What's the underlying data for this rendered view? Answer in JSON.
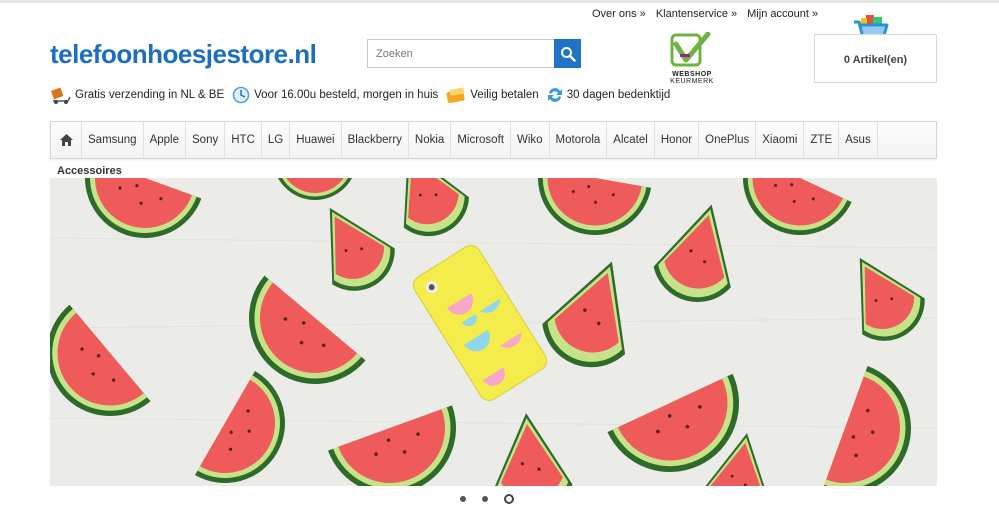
{
  "toplinks": {
    "about": "Over ons »",
    "service": "Klantenservice »",
    "account": "Mijn account »"
  },
  "logo": {
    "text_main": "telefoonhoesjestore",
    "text_tld": ".nl"
  },
  "search": {
    "placeholder": "Zoeken",
    "value": ""
  },
  "keurmerk": {
    "line1": "WEBSHOP",
    "line2": "KEURMERK"
  },
  "cart": {
    "label": "0 Artikel(en)"
  },
  "usps": [
    {
      "icon": "delivery-truck-icon",
      "text": "Gratis verzending in NL & BE"
    },
    {
      "icon": "clock-icon",
      "text": "Voor 16.00u besteld, morgen in huis"
    },
    {
      "icon": "wallet-icon",
      "text": "Veilig betalen"
    },
    {
      "icon": "return-arrows-icon",
      "text": "30 dagen bedenktijd"
    }
  ],
  "nav": {
    "items": [
      "Samsung",
      "Apple",
      "Sony",
      "HTC",
      "LG",
      "Huawei",
      "Blackberry",
      "Nokia",
      "Microsoft",
      "Wiko",
      "Motorola",
      "Alcatel",
      "Honor",
      "OnePlus",
      "Xiaomi",
      "ZTE",
      "Asus"
    ],
    "second_row": "Accessoires"
  },
  "slider": {
    "slides": 3,
    "active": 3
  },
  "colors": {
    "brand_blue": "#1a6fbf",
    "search_btn": "#1f73c6",
    "keurmerk_green": "#6cb33f"
  }
}
